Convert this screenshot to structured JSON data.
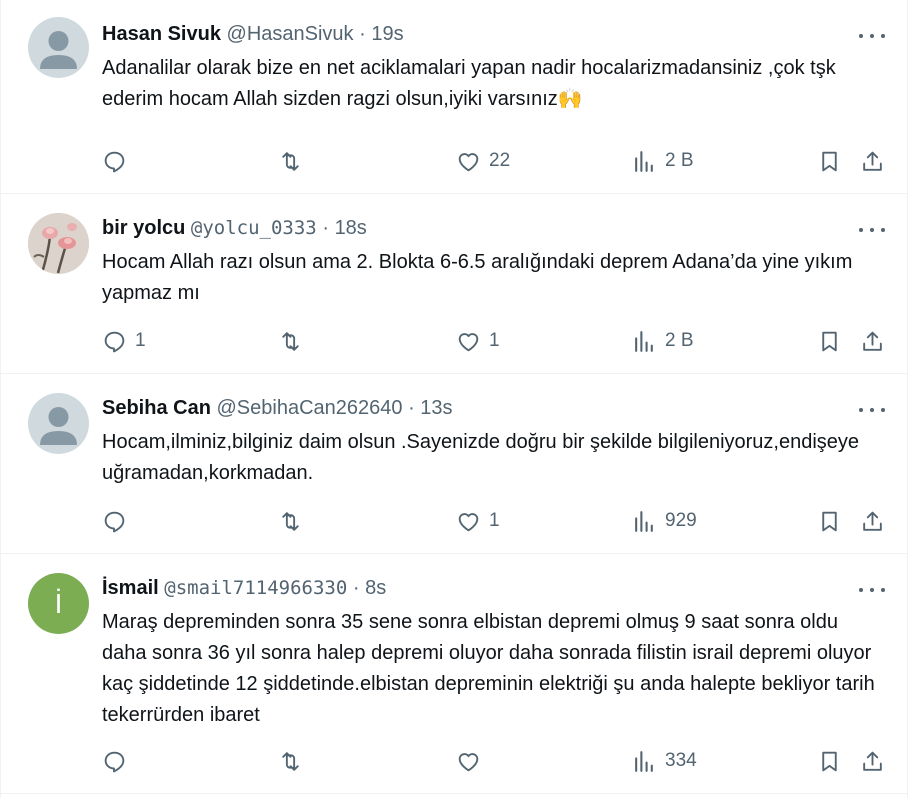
{
  "tweets": [
    {
      "name": "Hasan Sivuk",
      "handle": "@HasanSivuk",
      "separator": "·",
      "time": "19s",
      "text": "Adanalilar olarak bize en net aciklamalari yapan nadir hocalarizmadansiniz ,çok tşk ederim hocam Allah sizden ragzi olsun,iyiki varsınız🙌",
      "replies": "",
      "retweets": "",
      "likes": "22",
      "views": "2 B",
      "avatar": "default-avatar"
    },
    {
      "name": "bir yolcu",
      "handle": "@yolcu_0333",
      "separator": "·",
      "time": "18s",
      "text": "Hocam Allah razı olsun ama 2. Blokta 6-6.5 aralığındaki deprem Adana’da yine yıkım yapmaz mı",
      "replies": "1",
      "retweets": "",
      "likes": "1",
      "views": "2 B",
      "avatar": "flower-photo"
    },
    {
      "name": "Sebiha Can",
      "handle": "@SebihaCan262640",
      "separator": "·",
      "time": "13s",
      "text": "Hocam,ilminiz,bilginiz daim olsun .Sayenizde doğru bir şekilde bilgileniyoruz,endişeye uğramadan,korkmadan.",
      "replies": "",
      "retweets": "",
      "likes": "1",
      "views": "929",
      "avatar": "default-avatar"
    },
    {
      "name": "İsmail",
      "handle": "@smail7114966330",
      "separator": "·",
      "time": "8s",
      "text": "Maraş depreminden sonra 35 sene sonra elbistan depremi olmuş 9 saat sonra oldu daha sonra 36 yıl sonra halep depremi oluyor daha sonrada filistin israil depremi oluyor kaç şiddetinde 12 şiddetinde.elbistan depreminin elektriği şu anda halepte bekliyor tarih tekerrürden ibaret",
      "replies": "",
      "retweets": "",
      "likes": "",
      "views": "334",
      "avatar": "letter-avatar",
      "avatar_letter": "İ",
      "avatar_color": "#7cad53"
    }
  ],
  "icons": {
    "reply": "reply-icon",
    "retweet": "retweet-icon",
    "like": "heart-icon",
    "views": "views-icon",
    "bookmark": "bookmark-icon",
    "share": "share-icon",
    "more": "more-icon"
  },
  "colors": {
    "text": "#0f1419",
    "secondary": "#536471",
    "border": "#eff3f4"
  }
}
